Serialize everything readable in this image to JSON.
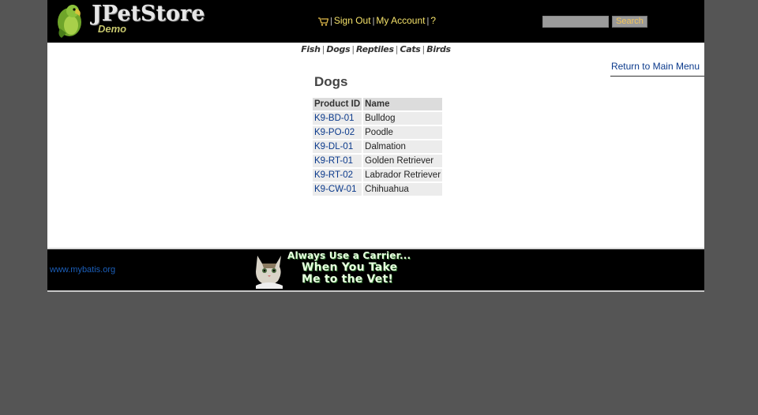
{
  "header": {
    "brand": "JPetStore",
    "brand_sub": "Demo",
    "menu": {
      "sign_out": "Sign Out",
      "my_account": "My Account",
      "help": "?"
    },
    "search": {
      "value": "",
      "button_label": "Search"
    }
  },
  "quicklinks": [
    "Fish",
    "Dogs",
    "Reptiles",
    "Cats",
    "Birds"
  ],
  "content": {
    "back_link": "Return to Main Menu",
    "category_title": "Dogs",
    "columns": [
      "Product ID",
      "Name"
    ],
    "products": [
      {
        "id": "K9-BD-01",
        "name": "Bulldog"
      },
      {
        "id": "K9-PO-02",
        "name": "Poodle"
      },
      {
        "id": "K9-DL-01",
        "name": "Dalmation"
      },
      {
        "id": "K9-RT-01",
        "name": "Golden Retriever"
      },
      {
        "id": "K9-RT-02",
        "name": "Labrador Retriever"
      },
      {
        "id": "K9-CW-01",
        "name": "Chihuahua"
      }
    ]
  },
  "footer": {
    "link": "www.mybatis.org",
    "banner_lines": [
      "Always Use a Carrier...",
      "When You Take",
      "Me to the Vet!"
    ]
  },
  "colors": {
    "page_bg": "#555555",
    "header_bg": "#000000",
    "menu_link": "#f5e26a",
    "table_link": "#0b3a8c"
  }
}
